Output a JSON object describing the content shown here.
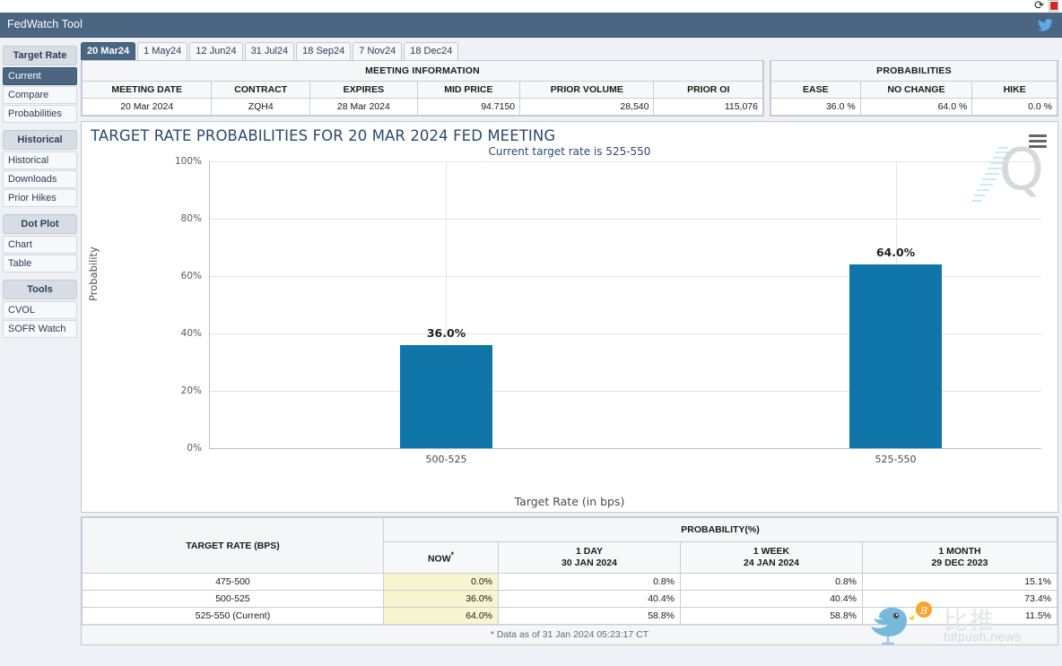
{
  "browser_bar": {
    "refresh_icon": "refresh-icon",
    "pdf_icon": "pdf-icon",
    "refresh_glyph": "⟳"
  },
  "header": {
    "title": "FedWatch Tool",
    "twitter_icon": "twitter-icon",
    "twitter_glyph": "🐦",
    "bg_color": "#4a6682"
  },
  "sidebar": {
    "groups": [
      {
        "title": "Target Rate",
        "items": [
          {
            "label": "Current",
            "active": true
          },
          {
            "label": "Compare",
            "active": false
          },
          {
            "label": "Probabilities",
            "active": false
          }
        ]
      },
      {
        "title": "Historical",
        "items": [
          {
            "label": "Historical",
            "active": false
          },
          {
            "label": "Downloads",
            "active": false
          },
          {
            "label": "Prior Hikes",
            "active": false
          }
        ]
      },
      {
        "title": "Dot Plot",
        "items": [
          {
            "label": "Chart",
            "active": false
          },
          {
            "label": "Table",
            "active": false
          }
        ]
      },
      {
        "title": "Tools",
        "items": [
          {
            "label": "CVOL",
            "active": false
          },
          {
            "label": "SOFR Watch",
            "active": false
          }
        ]
      }
    ]
  },
  "tabs": [
    {
      "label": "20 Mar24",
      "active": true
    },
    {
      "label": "1 May24",
      "active": false
    },
    {
      "label": "12 Jun24",
      "active": false
    },
    {
      "label": "31 Jul24",
      "active": false
    },
    {
      "label": "18 Sep24",
      "active": false
    },
    {
      "label": "7 Nov24",
      "active": false
    },
    {
      "label": "18 Dec24",
      "active": false
    }
  ],
  "meeting_information": {
    "band_title": "MEETING INFORMATION",
    "columns": [
      "MEETING DATE",
      "CONTRACT",
      "EXPIRES",
      "MID PRICE",
      "PRIOR VOLUME",
      "PRIOR OI"
    ],
    "row": {
      "meeting_date": "20 Mar 2024",
      "contract": "ZQH4",
      "expires": "28 Mar 2024",
      "mid_price": "94.7150",
      "prior_volume": "28,540",
      "prior_oi": "115,076"
    }
  },
  "probabilities_summary": {
    "band_title": "PROBABILITIES",
    "columns": [
      "EASE",
      "NO CHANGE",
      "HIKE"
    ],
    "row": {
      "ease": "36.0 %",
      "no_change": "64.0 %",
      "hike": "0.0 %"
    }
  },
  "chart_panel": {
    "title": "TARGET RATE PROBABILITIES FOR 20 MAR 2024 FED MEETING",
    "subtitle": "Current target rate is 525-550",
    "menu_icon": "hamburger-menu-icon",
    "watermark_letter": "Q"
  },
  "chart_data": {
    "type": "bar",
    "title": "TARGET RATE PROBABILITIES FOR 20 MAR 2024 FED MEETING",
    "subtitle": "Current target rate is 525-550",
    "categories": [
      "500-525",
      "525-550"
    ],
    "values": [
      36.0,
      64.0
    ],
    "data_labels": [
      "36.0%",
      "64.0%"
    ],
    "xlabel": "Target Rate (in bps)",
    "ylabel": "Probability",
    "ylim": [
      0,
      100
    ],
    "yticks": [
      0,
      20,
      40,
      60,
      80,
      100
    ],
    "ytick_labels": [
      "0%",
      "20%",
      "40%",
      "60%",
      "80%",
      "100%"
    ],
    "grid": true,
    "legend": "none",
    "bar_color": "#1075a8"
  },
  "probability_table": {
    "row_header": "TARGET RATE (BPS)",
    "band_title": "PROBABILITY(%)",
    "columns": [
      {
        "title": "NOW",
        "sub": "",
        "star": "*"
      },
      {
        "title": "1 DAY",
        "sub": "30 JAN 2024"
      },
      {
        "title": "1 WEEK",
        "sub": "24 JAN 2024"
      },
      {
        "title": "1 MONTH",
        "sub": "29 DEC 2023"
      }
    ],
    "rows": [
      {
        "rate": "475-500",
        "now": "0.0%",
        "day1": "0.8%",
        "week1": "0.8%",
        "month1": "15.1%"
      },
      {
        "rate": "500-525",
        "now": "36.0%",
        "day1": "40.4%",
        "week1": "40.4%",
        "month1": "73.4%"
      },
      {
        "rate": "525-550 (Current)",
        "now": "64.0%",
        "day1": "58.8%",
        "week1": "58.8%",
        "month1": "11.5%"
      }
    ],
    "footnote": "* Data as of 31 Jan 2024 05:23:17 CT"
  },
  "watermark": {
    "cn_text": "比推",
    "en_text": "bitpush.news",
    "bird_icon": "bird-icon",
    "bitcoin_icon": "bitcoin-icon"
  }
}
